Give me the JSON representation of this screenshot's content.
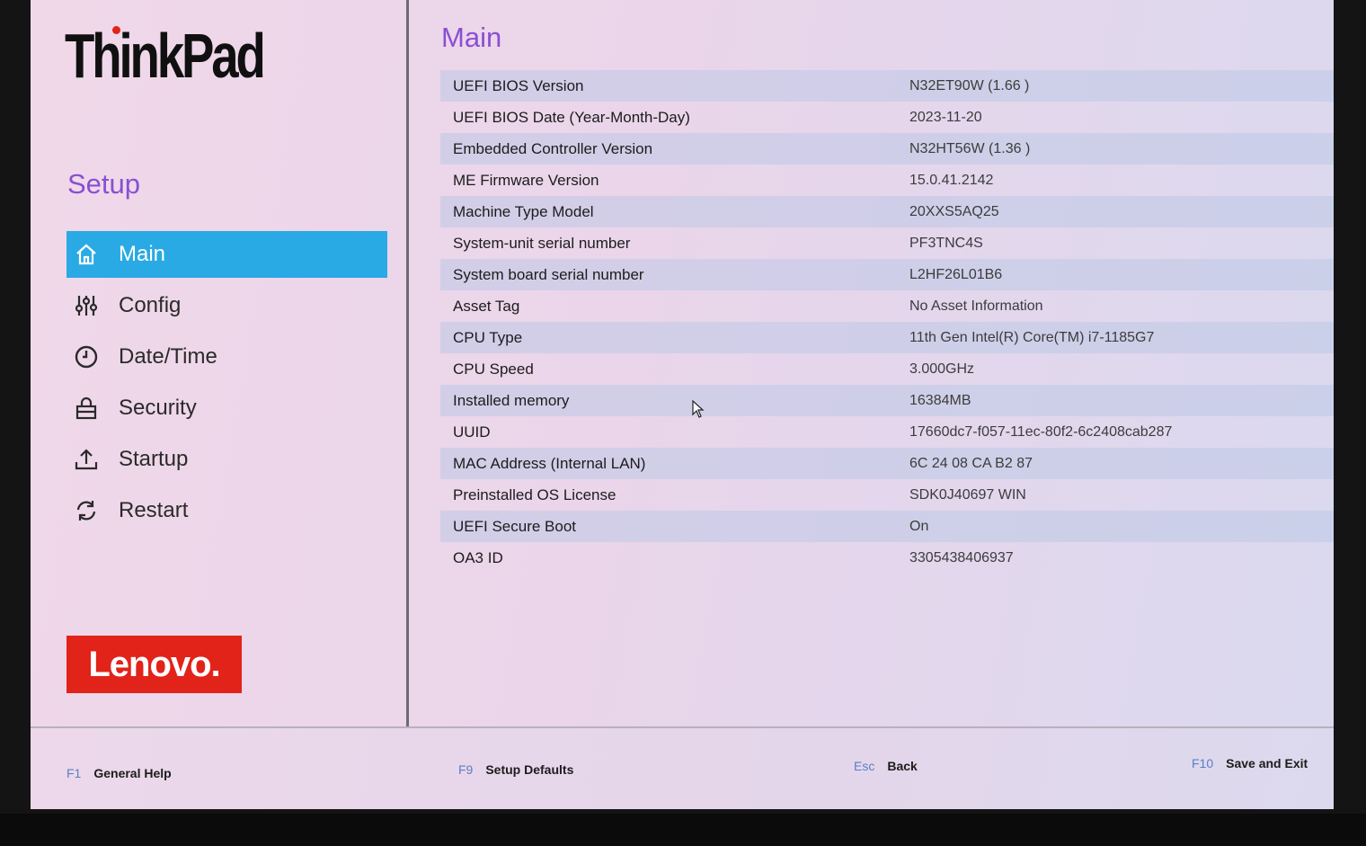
{
  "brand": {
    "product_logo": "ThinkPad",
    "vendor_logo": "Lenovo."
  },
  "sidebar": {
    "title": "Setup",
    "items": [
      {
        "label": "Main",
        "icon": "home-icon",
        "active": true
      },
      {
        "label": "Config",
        "icon": "sliders-icon",
        "active": false
      },
      {
        "label": "Date/Time",
        "icon": "clock-icon",
        "active": false
      },
      {
        "label": "Security",
        "icon": "lock-icon",
        "active": false
      },
      {
        "label": "Startup",
        "icon": "upload-icon",
        "active": false
      },
      {
        "label": "Restart",
        "icon": "refresh-icon",
        "active": false
      }
    ]
  },
  "main": {
    "title": "Main",
    "rows": [
      {
        "label": "UEFI BIOS Version",
        "value": "N32ET90W (1.66 )"
      },
      {
        "label": "UEFI BIOS Date (Year-Month-Day)",
        "value": "2023-11-20"
      },
      {
        "label": "Embedded Controller Version",
        "value": "N32HT56W (1.36 )"
      },
      {
        "label": "ME Firmware Version",
        "value": "15.0.41.2142"
      },
      {
        "label": "Machine Type Model",
        "value": "20XXS5AQ25"
      },
      {
        "label": "System-unit serial number",
        "value": "PF3TNC4S"
      },
      {
        "label": "System board serial number",
        "value": "L2HF26L01B6"
      },
      {
        "label": "Asset Tag",
        "value": "No Asset Information"
      },
      {
        "label": "CPU Type",
        "value": "11th Gen Intel(R) Core(TM) i7-1185G7"
      },
      {
        "label": "CPU Speed",
        "value": "3.000GHz"
      },
      {
        "label": "Installed memory",
        "value": "16384MB"
      },
      {
        "label": "UUID",
        "value": "17660dc7-f057-11ec-80f2-6c2408cab287"
      },
      {
        "label": "MAC Address (Internal LAN)",
        "value": "6C 24 08 CA B2 87"
      },
      {
        "label": "Preinstalled OS License",
        "value": "SDK0J40697 WIN"
      },
      {
        "label": "UEFI Secure Boot",
        "value": "On"
      },
      {
        "label": "OA3 ID",
        "value": "3305438406937"
      }
    ]
  },
  "footer": {
    "f1": {
      "key": "F1",
      "action": "General Help"
    },
    "f9": {
      "key": "F9",
      "action": "Setup Defaults"
    },
    "esc": {
      "key": "Esc",
      "action": "Back"
    },
    "f10": {
      "key": "F10",
      "action": "Save and Exit"
    }
  },
  "colors": {
    "accent": "#29aae4",
    "title": "#8a4fd2",
    "lenovo_red": "#e2231a"
  }
}
